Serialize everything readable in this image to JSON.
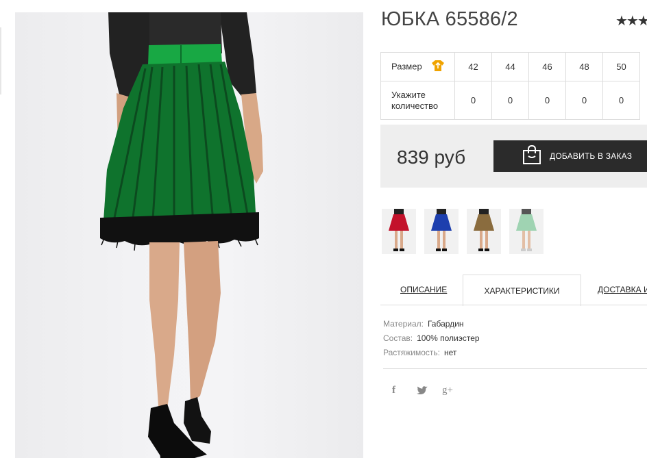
{
  "product": {
    "title": "ЮБКА 65586/2",
    "rating_stars": "★★★"
  },
  "size_table": {
    "size_label": "Размер",
    "qty_label": "Укажите количество",
    "sizes": [
      "42",
      "44",
      "46",
      "48",
      "50"
    ],
    "quantities": [
      "0",
      "0",
      "0",
      "0",
      "0"
    ]
  },
  "buy": {
    "price": "839 руб",
    "add_button": "ДОБАВИТЬ В ЗАКАЗ"
  },
  "color_variants": [
    "red",
    "blue",
    "beige",
    "mint"
  ],
  "tabs": {
    "description": "ОПИСАНИЕ",
    "characteristics": "ХАРАКТЕРИСТИКИ",
    "delivery": "ДОСТАВКА И"
  },
  "specs": [
    {
      "key": "Материал:",
      "value": "Габардин"
    },
    {
      "key": "Состав:",
      "value": "100% полиэстер"
    },
    {
      "key": "Растяжимость:",
      "value": "нет"
    }
  ],
  "social": {
    "facebook": "f",
    "twitter": "twitter-icon",
    "googleplus": "g+"
  },
  "colors": {
    "skirt_green": "#159a3c",
    "tulle": "#111111",
    "button_bg": "#2b2b2b",
    "icon_orange": "#f0a300"
  }
}
